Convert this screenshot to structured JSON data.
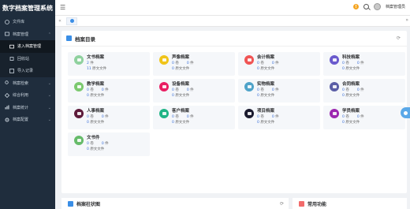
{
  "app": {
    "title": "数字档案管理系统"
  },
  "sidebar": {
    "items": [
      {
        "label": "文件库",
        "icon": "library-icon",
        "expandable": false
      },
      {
        "label": "档案管理",
        "icon": "archive-icon",
        "expandable": true,
        "children": [
          {
            "label": "进入档案管理"
          },
          {
            "label": "回收站"
          },
          {
            "label": "导入记录"
          }
        ]
      },
      {
        "label": "档案检索",
        "icon": "search-icon",
        "expandable": true
      },
      {
        "label": "综合利用",
        "icon": "share-icon",
        "expandable": true
      },
      {
        "label": "档案统计",
        "icon": "chart-icon",
        "expandable": true
      },
      {
        "label": "档案配置",
        "icon": "gear-icon",
        "expandable": true
      }
    ]
  },
  "topbar": {
    "warning_badge": "!",
    "username": "档案管理员"
  },
  "catalog": {
    "title": "档案目录",
    "tiles": [
      {
        "name": "文书档案",
        "line1": [
          "2",
          "件"
        ],
        "line2": [
          "11",
          "原文文件"
        ],
        "color": "#8fd19e",
        "variant": "items"
      },
      {
        "name": "声像档案",
        "line1": [
          "0",
          "卷",
          "0",
          "件"
        ],
        "line2": [
          "0",
          "原文文件"
        ],
        "color": "#f0c419"
      },
      {
        "name": "会计档案",
        "line1": [
          "0",
          "卷",
          "0",
          "件"
        ],
        "line2": [
          "0",
          "原文文件"
        ],
        "color": "#f05454"
      },
      {
        "name": "科技档案",
        "line1": [
          "0",
          "卷",
          "0",
          "件"
        ],
        "line2": [
          "0",
          "原文文件"
        ],
        "color": "#6a5acd"
      },
      {
        "name": "教学档案",
        "line1": [
          "0",
          "卷",
          "0",
          "件"
        ],
        "line2": [
          "0",
          "原文文件"
        ],
        "color": "#7bc96f"
      },
      {
        "name": "设备档案",
        "line1": [
          "0",
          "卷",
          "0",
          "件"
        ],
        "line2": [
          "0",
          "原文文件"
        ],
        "color": "#e91e63"
      },
      {
        "name": "实物档案",
        "line1": [
          "0",
          "卷",
          "0",
          "件"
        ],
        "line2": [
          "0",
          "原文文件"
        ],
        "color": "#4fa3c9"
      },
      {
        "name": "合同档案",
        "line1": [
          "0",
          "卷",
          "0",
          "件"
        ],
        "line2": [
          "0",
          "原文文件"
        ],
        "color": "#5b5ea6"
      },
      {
        "name": "人事档案",
        "line1": [
          "0",
          "卷",
          "0",
          "件"
        ],
        "line2": [
          "0",
          "原文文件"
        ],
        "color": "#5d1a3a"
      },
      {
        "name": "客户档案",
        "line1": [
          "0",
          "卷",
          "0",
          "件"
        ],
        "line2": [
          "0",
          "原文文件"
        ],
        "color": "#20b486"
      },
      {
        "name": "项目档案",
        "line1": [
          "0",
          "卷",
          "0",
          "件"
        ],
        "line2": [
          "0",
          "原文文件"
        ],
        "color": "#1a1a2e"
      },
      {
        "name": "学员档案",
        "line1": [
          "0",
          "卷",
          "0",
          "件"
        ],
        "line2": [
          "0",
          "原文文件"
        ],
        "color": "#9c27b0"
      },
      {
        "name": "文书件",
        "line1": [
          "0",
          "卷",
          "0",
          "件"
        ],
        "line2": [
          "0",
          "原文文件"
        ],
        "color": "#66bb6a"
      }
    ]
  },
  "bottom": {
    "left_title": "档案柱状图",
    "right_title": "常用功能"
  },
  "colors": {
    "sidebar_bg": "#1f2d3d",
    "accent": "#3a8ee6"
  }
}
